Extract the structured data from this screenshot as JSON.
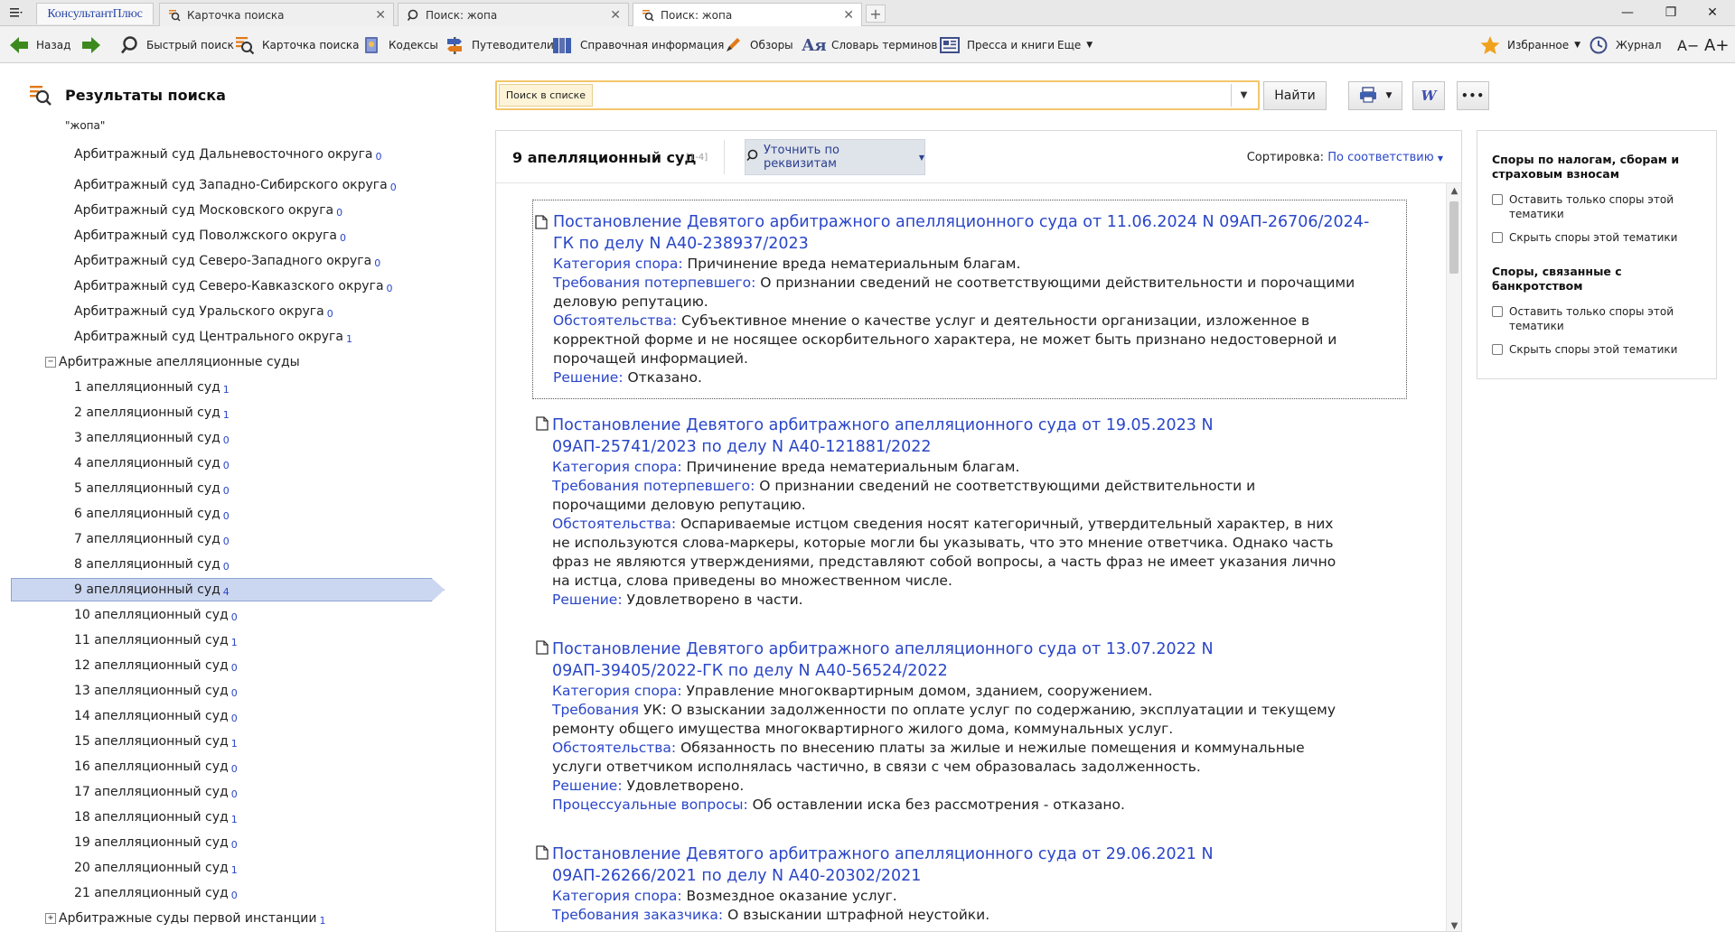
{
  "tabbar": {
    "brand": "КонсультантПлюс",
    "tabs": [
      {
        "label": "Карточка поиска"
      },
      {
        "label": "Поиск: жопа"
      },
      {
        "label": "Поиск: жопа"
      }
    ]
  },
  "toolbar": {
    "back": "Назад",
    "quick_search": "Быстрый поиск",
    "search_card": "Карточка поиска",
    "codes": "Кодексы",
    "guides": "Путеводители",
    "reference": "Справочная информация",
    "reviews": "Обзоры",
    "dictionary": "Словарь терминов",
    "press": "Пресса и книги",
    "more": "Еще",
    "favorites": "Избранное",
    "journal": "Журнал",
    "font_smaller": "A−",
    "font_larger": "A+"
  },
  "left": {
    "title": "Результаты поиска",
    "query": "\"жопа\"",
    "items": [
      {
        "label": "Арбитражный суд Дальневосточного округа",
        "count": "0"
      },
      {
        "label": "Арбитражный суд Западно-Сибирского округа",
        "count": "0"
      },
      {
        "label": "Арбитражный суд Московского округа",
        "count": "0"
      },
      {
        "label": "Арбитражный суд Поволжского округа",
        "count": "0"
      },
      {
        "label": "Арбитражный суд Северо-Западного округа",
        "count": "0"
      },
      {
        "label": "Арбитражный суд Северо-Кавказского округа",
        "count": "0"
      },
      {
        "label": "Арбитражный суд Уральского округа",
        "count": "0"
      },
      {
        "label": "Арбитражный суд Центрального округа",
        "count": "1"
      },
      {
        "label": "Арбитражные апелляционные суды",
        "count": ""
      },
      {
        "label": "1 апелляционный суд",
        "count": "1"
      },
      {
        "label": "2 апелляционный суд",
        "count": "1"
      },
      {
        "label": "3 апелляционный суд",
        "count": "0"
      },
      {
        "label": "4 апелляционный суд",
        "count": "0"
      },
      {
        "label": "5 апелляционный суд",
        "count": "0"
      },
      {
        "label": "6 апелляционный суд",
        "count": "0"
      },
      {
        "label": "7 апелляционный суд",
        "count": "0"
      },
      {
        "label": "8 апелляционный суд",
        "count": "0"
      },
      {
        "label": "9 апелляционный суд",
        "count": "4"
      },
      {
        "label": "10 апелляционный суд",
        "count": "0"
      },
      {
        "label": "11 апелляционный суд",
        "count": "1"
      },
      {
        "label": "12 апелляционный суд",
        "count": "0"
      },
      {
        "label": "13 апелляционный суд",
        "count": "0"
      },
      {
        "label": "14 апелляционный суд",
        "count": "0"
      },
      {
        "label": "15 апелляционный суд",
        "count": "1"
      },
      {
        "label": "16 апелляционный суд",
        "count": "0"
      },
      {
        "label": "17 апелляционный суд",
        "count": "0"
      },
      {
        "label": "18 апелляционный суд",
        "count": "1"
      },
      {
        "label": "19 апелляционный суд",
        "count": "0"
      },
      {
        "label": "20 апелляционный суд",
        "count": "1"
      },
      {
        "label": "21 апелляционный суд",
        "count": "0"
      },
      {
        "label": "Арбитражные суды первой инстанции",
        "count": "1"
      }
    ]
  },
  "search": {
    "label": "Поиск в списке",
    "value": "",
    "find_button": "Найти"
  },
  "main": {
    "title": "9 апелляционный суд",
    "range": "[1-4]",
    "refine": "Уточнить по реквизитам",
    "sort_label": "Сортировка:",
    "sort_value": "По соответствию",
    "docs": [
      {
        "title": "Постановление Девятого арбитражного апелляционного суда от 11.06.2024 N 09АП-26706/2024-ГК по делу N А40-238937/2023",
        "fields": [
          {
            "label": "Категория спора:",
            "text": " Причинение вреда нематериальным благам."
          },
          {
            "label": "Требования потерпевшего:",
            "text": " О признании сведений не соответствующими действительности и порочащими деловую репутацию."
          },
          {
            "label": "Обстоятельства:",
            "text": " Субъективное мнение о качестве услуг и деятельности организации, изложенное в корректной форме и не носящее оскорбительного характера, не может быть признано недостоверной и порочащей информацией."
          },
          {
            "label": "Решение:",
            "text": " Отказано."
          }
        ]
      },
      {
        "title": "Постановление Девятого арбитражного апелляционного суда от 19.05.2023 N 09АП-25741/2023 по делу N А40-121881/2022",
        "fields": [
          {
            "label": "Категория спора:",
            "text": " Причинение вреда нематериальным благам."
          },
          {
            "label": "Требования потерпевшего:",
            "text": " О признании сведений не соответствующими действительности и порочащими деловую репутацию."
          },
          {
            "label": "Обстоятельства:",
            "text": " Оспариваемые истцом сведения носят категоричный, утвердительный характер, в них не используются слова-маркеры, которые могли бы указывать, что это мнение ответчика. Однако часть фраз не являются утверждениями, представляют собой вопросы, а часть фраз не имеет указания лично на истца, слова приведены во множественном числе."
          },
          {
            "label": "Решение:",
            "text": " Удовлетворено в части."
          }
        ]
      },
      {
        "title": "Постановление Девятого арбитражного апелляционного суда от 13.07.2022 N 09АП-39405/2022-ГК по делу N А40-56524/2022",
        "fields": [
          {
            "label": "Категория спора:",
            "text": " Управление многоквартирным домом, зданием, сооружением."
          },
          {
            "label": "Требования",
            "text": " УК: О взыскании задолженности по оплате услуг по содержанию, эксплуатации и текущему ремонту общего имущества многоквартирного жилого дома, коммунальных услуг."
          },
          {
            "label": "Обстоятельства:",
            "text": " Обязанность по внесению платы за жилые и нежилые помещения и коммунальные услуги ответчиком исполнялась частично, в связи с чем образовалась задолженность."
          },
          {
            "label": "Решение:",
            "text": " Удовлетворено."
          },
          {
            "label": "Процессуальные вопросы:",
            "text": " Об оставлении иска без рассмотрения - отказано."
          }
        ]
      },
      {
        "title": "Постановление Девятого арбитражного апелляционного суда от 29.06.2021 N 09АП-26266/2021 по делу N А40-20302/2021",
        "fields": [
          {
            "label": "Категория спора:",
            "text": " Возмездное оказание услуг."
          },
          {
            "label": "Требования заказчика:",
            "text": " О взыскании штрафной неустойки."
          }
        ]
      }
    ]
  },
  "right": {
    "group1_title": "Споры по налогам, сборам и страховым взносам",
    "group1_opt1": "Оставить только споры этой тематики",
    "group1_opt2": "Скрыть споры этой тематики",
    "group2_title": "Споры, связанные с банкротством",
    "group2_opt1": "Оставить только споры этой тематики",
    "group2_opt2": "Скрыть споры этой тематики"
  },
  "colors": {
    "link": "#2a46c8",
    "accent": "#f3c56a",
    "selected": "#cbd6f0"
  }
}
